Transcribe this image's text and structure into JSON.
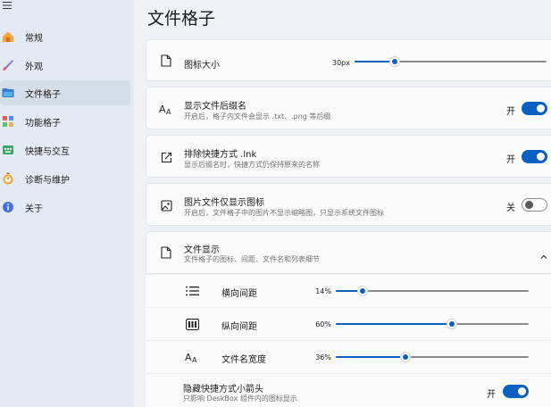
{
  "sidebar": {
    "items": [
      {
        "label": "常规",
        "icon": "home-icon"
      },
      {
        "label": "外观",
        "icon": "brush-icon"
      },
      {
        "label": "文件格子",
        "icon": "folder-icon"
      },
      {
        "label": "功能格子",
        "icon": "grid-icon"
      },
      {
        "label": "快捷与交互",
        "icon": "keyboard-icon"
      },
      {
        "label": "诊断与维护",
        "icon": "stopwatch-icon"
      },
      {
        "label": "关于",
        "icon": "info-icon"
      }
    ],
    "active_index": 2
  },
  "page": {
    "title": "文件格子"
  },
  "settings": {
    "icon_size": {
      "title": "图标大小",
      "value_label": "30px",
      "fraction": 0.21
    },
    "show_extension": {
      "title": "显示文件后缀名",
      "desc": "开启后，格子内文件会显示 .txt、.png 等后缀",
      "state_label": "开",
      "on": true
    },
    "exclude_lnk": {
      "title": "排除快捷方式 .lnk",
      "desc": "显示后缀名时，快捷方式仍保持原来的名称",
      "state_label": "开",
      "on": true
    },
    "image_icon_only": {
      "title": "图片文件仅显示图标",
      "desc": "开启后，文件格子中的图片不显示缩略图，只显示系统文件图标",
      "state_label": "关",
      "on": false
    },
    "file_display": {
      "title": "文件显示",
      "desc": "文件格子的图标、间距、文件名和列表细节",
      "rows": [
        {
          "label": "横向间距",
          "value_label": "14%",
          "fraction": 0.14,
          "icon": "list-icon"
        },
        {
          "label": "纵向间距",
          "value_label": "60%",
          "fraction": 0.6,
          "icon": "layout-icon"
        },
        {
          "label": "文件名宽度",
          "value_label": "36%",
          "fraction": 0.36,
          "icon": "font-size-icon"
        }
      ]
    },
    "hide_arrow": {
      "title": "隐藏快捷方式小箭头",
      "desc": "只影响 DeskBox 组件内的图标显示",
      "state_label": "开",
      "on": true
    }
  },
  "colors": {
    "accent": "#0a5fbf"
  }
}
